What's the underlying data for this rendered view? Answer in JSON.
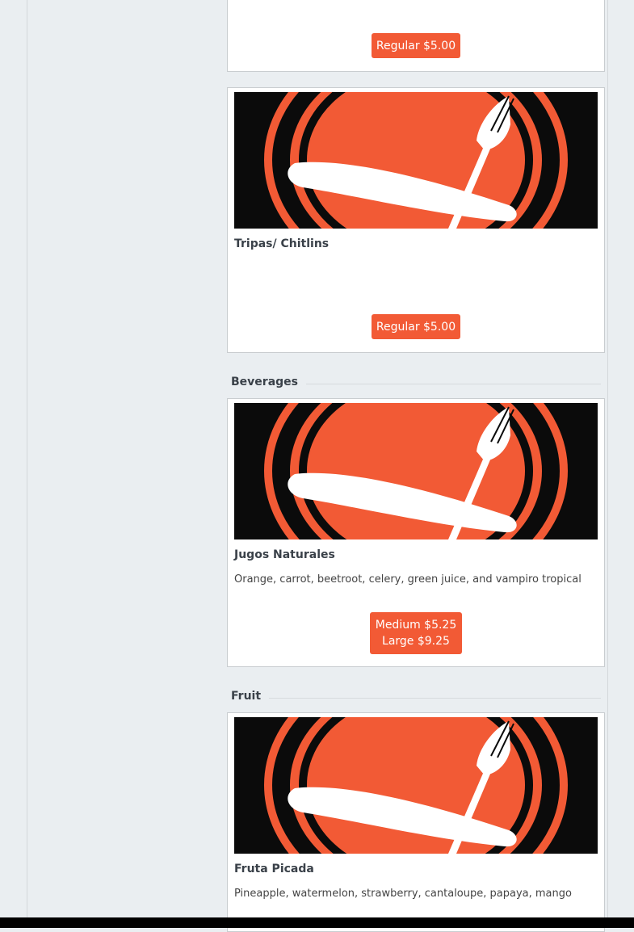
{
  "colors": {
    "accent": "#f25a35",
    "page_bg": "#eaeef1",
    "image_bg": "#0b0b0b"
  },
  "image_icon": "plate-knife-fork-logo",
  "items": [
    {
      "title": "",
      "description": "",
      "prices": [
        "Regular $5.00"
      ]
    },
    {
      "title": "Tripas/ Chitlins",
      "description": "",
      "prices": [
        "Regular $5.00"
      ]
    },
    {
      "title": "Jugos Naturales",
      "description": "Orange, carrot, beetroot, celery, green juice, and vampiro tropical",
      "prices": [
        "Medium $5.25",
        "Large $9.25"
      ]
    },
    {
      "title": "Fruta Picada",
      "description": "Pineapple, watermelon, strawberry, cantaloupe, papaya, mango",
      "prices": []
    }
  ],
  "sections": {
    "beverages": "Beverages",
    "fruit": "Fruit"
  }
}
